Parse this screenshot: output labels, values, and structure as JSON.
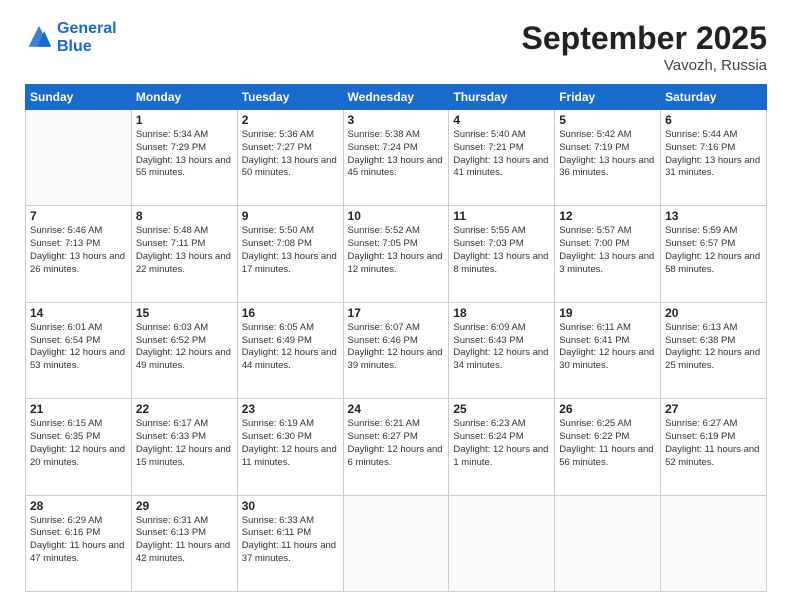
{
  "header": {
    "logo_line1": "General",
    "logo_line2": "Blue",
    "month": "September 2025",
    "location": "Vavozh, Russia"
  },
  "days_of_week": [
    "Sunday",
    "Monday",
    "Tuesday",
    "Wednesday",
    "Thursday",
    "Friday",
    "Saturday"
  ],
  "weeks": [
    [
      {
        "day": null
      },
      {
        "day": "1",
        "sunrise": "5:34 AM",
        "sunset": "7:29 PM",
        "daylight": "13 hours and 55 minutes."
      },
      {
        "day": "2",
        "sunrise": "5:36 AM",
        "sunset": "7:27 PM",
        "daylight": "13 hours and 50 minutes."
      },
      {
        "day": "3",
        "sunrise": "5:38 AM",
        "sunset": "7:24 PM",
        "daylight": "13 hours and 45 minutes."
      },
      {
        "day": "4",
        "sunrise": "5:40 AM",
        "sunset": "7:21 PM",
        "daylight": "13 hours and 41 minutes."
      },
      {
        "day": "5",
        "sunrise": "5:42 AM",
        "sunset": "7:19 PM",
        "daylight": "13 hours and 36 minutes."
      },
      {
        "day": "6",
        "sunrise": "5:44 AM",
        "sunset": "7:16 PM",
        "daylight": "13 hours and 31 minutes."
      }
    ],
    [
      {
        "day": "7",
        "sunrise": "5:46 AM",
        "sunset": "7:13 PM",
        "daylight": "13 hours and 26 minutes."
      },
      {
        "day": "8",
        "sunrise": "5:48 AM",
        "sunset": "7:11 PM",
        "daylight": "13 hours and 22 minutes."
      },
      {
        "day": "9",
        "sunrise": "5:50 AM",
        "sunset": "7:08 PM",
        "daylight": "13 hours and 17 minutes."
      },
      {
        "day": "10",
        "sunrise": "5:52 AM",
        "sunset": "7:05 PM",
        "daylight": "13 hours and 12 minutes."
      },
      {
        "day": "11",
        "sunrise": "5:55 AM",
        "sunset": "7:03 PM",
        "daylight": "13 hours and 8 minutes."
      },
      {
        "day": "12",
        "sunrise": "5:57 AM",
        "sunset": "7:00 PM",
        "daylight": "13 hours and 3 minutes."
      },
      {
        "day": "13",
        "sunrise": "5:59 AM",
        "sunset": "6:57 PM",
        "daylight": "12 hours and 58 minutes."
      }
    ],
    [
      {
        "day": "14",
        "sunrise": "6:01 AM",
        "sunset": "6:54 PM",
        "daylight": "12 hours and 53 minutes."
      },
      {
        "day": "15",
        "sunrise": "6:03 AM",
        "sunset": "6:52 PM",
        "daylight": "12 hours and 49 minutes."
      },
      {
        "day": "16",
        "sunrise": "6:05 AM",
        "sunset": "6:49 PM",
        "daylight": "12 hours and 44 minutes."
      },
      {
        "day": "17",
        "sunrise": "6:07 AM",
        "sunset": "6:46 PM",
        "daylight": "12 hours and 39 minutes."
      },
      {
        "day": "18",
        "sunrise": "6:09 AM",
        "sunset": "6:43 PM",
        "daylight": "12 hours and 34 minutes."
      },
      {
        "day": "19",
        "sunrise": "6:11 AM",
        "sunset": "6:41 PM",
        "daylight": "12 hours and 30 minutes."
      },
      {
        "day": "20",
        "sunrise": "6:13 AM",
        "sunset": "6:38 PM",
        "daylight": "12 hours and 25 minutes."
      }
    ],
    [
      {
        "day": "21",
        "sunrise": "6:15 AM",
        "sunset": "6:35 PM",
        "daylight": "12 hours and 20 minutes."
      },
      {
        "day": "22",
        "sunrise": "6:17 AM",
        "sunset": "6:33 PM",
        "daylight": "12 hours and 15 minutes."
      },
      {
        "day": "23",
        "sunrise": "6:19 AM",
        "sunset": "6:30 PM",
        "daylight": "12 hours and 11 minutes."
      },
      {
        "day": "24",
        "sunrise": "6:21 AM",
        "sunset": "6:27 PM",
        "daylight": "12 hours and 6 minutes."
      },
      {
        "day": "25",
        "sunrise": "6:23 AM",
        "sunset": "6:24 PM",
        "daylight": "12 hours and 1 minute."
      },
      {
        "day": "26",
        "sunrise": "6:25 AM",
        "sunset": "6:22 PM",
        "daylight": "11 hours and 56 minutes."
      },
      {
        "day": "27",
        "sunrise": "6:27 AM",
        "sunset": "6:19 PM",
        "daylight": "11 hours and 52 minutes."
      }
    ],
    [
      {
        "day": "28",
        "sunrise": "6:29 AM",
        "sunset": "6:16 PM",
        "daylight": "11 hours and 47 minutes."
      },
      {
        "day": "29",
        "sunrise": "6:31 AM",
        "sunset": "6:13 PM",
        "daylight": "11 hours and 42 minutes."
      },
      {
        "day": "30",
        "sunrise": "6:33 AM",
        "sunset": "6:11 PM",
        "daylight": "11 hours and 37 minutes."
      },
      {
        "day": null
      },
      {
        "day": null
      },
      {
        "day": null
      },
      {
        "day": null
      }
    ]
  ]
}
